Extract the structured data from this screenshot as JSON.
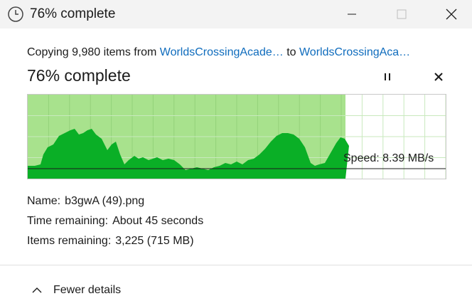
{
  "window": {
    "title": "76% complete",
    "icon": "clock-icon",
    "controls": [
      "minimize-icon",
      "maximize-icon",
      "close-icon"
    ]
  },
  "copy": {
    "prefix": "Copying 9,980 items from ",
    "source": "WorldsCrossingAcade…",
    "middle": " to ",
    "destination": "WorldsCrossingAca…"
  },
  "progress": {
    "heading": "76% complete",
    "fraction": 0.76,
    "pause_icon": "pause-icon",
    "cancel_icon": "close-icon"
  },
  "graph": {
    "speed_label": "Speed: 8.39 MB/s",
    "colors": {
      "done_bg": "#a8e28d",
      "area": "#0aaf26",
      "grid_done": "#93d27a",
      "grid_todo": "#c8e9bd",
      "speed_line": "#1b1b1b"
    }
  },
  "details": {
    "name_label": "Name:",
    "name_value": "b3gwA (49).png",
    "time_label": "Time remaining:",
    "time_value": "About 45 seconds",
    "items_label": "Items remaining:",
    "items_value": "3,225 (715 MB)"
  },
  "footer": {
    "toggle_label": "Fewer details",
    "toggle_icon": "chevron-up-icon"
  }
}
